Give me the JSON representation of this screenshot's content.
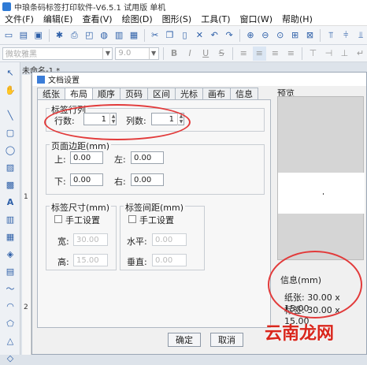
{
  "app": {
    "title": "中琅条码标签打印软件-V6.5.1 试用版 单机"
  },
  "menu": [
    "文件(F)",
    "编辑(E)",
    "查看(V)",
    "绘图(D)",
    "图形(S)",
    "工具(T)",
    "窗口(W)",
    "帮助(H)"
  ],
  "toolbar2": {
    "font_value": "微软雅黑",
    "size_value": "9.0",
    "bold": "B",
    "italic": "I",
    "underline": "U",
    "strike": "S"
  },
  "document_tab": "未命名-1 *",
  "ruler": [
    "1",
    "2"
  ],
  "dialog": {
    "title": "文档设置",
    "tabs": [
      "纸张",
      "布局",
      "顺序",
      "页码",
      "区间",
      "光标",
      "画布",
      "信息"
    ],
    "active_tab": "布局",
    "label_rows_cols": {
      "legend": "标签行列",
      "rows_label": "行数:",
      "rows_value": "1",
      "cols_label": "列数:",
      "cols_value": "1"
    },
    "margins": {
      "legend": "页面边距(mm)",
      "top_label": "上:",
      "top_value": "0.00",
      "left_label": "左:",
      "left_value": "0.00",
      "bottom_label": "下:",
      "bottom_value": "0.00",
      "right_label": "右:",
      "right_value": "0.00"
    },
    "label_size": {
      "legend": "标签尺寸(mm)",
      "manual": "手工设置",
      "width_label": "宽:",
      "width_value": "30.00",
      "height_label": "高:",
      "height_value": "15.00"
    },
    "label_spacing": {
      "legend": "标签间距(mm)",
      "manual": "手工设置",
      "h_label": "水平:",
      "h_value": "0.00",
      "v_label": "垂直:",
      "v_value": "0.00"
    },
    "preview_label": "预览",
    "info": {
      "label": "信息(mm)",
      "paper": "纸张: 30.00 x 15.00",
      "label_size": "标签: 30.00 x 15.00"
    },
    "ok": "确定",
    "cancel": "取消"
  },
  "watermark": "云南龙网",
  "colors": {
    "annotation": "#e23a3a",
    "watermark": "#d9261c",
    "accent": "#2f7bd6"
  }
}
